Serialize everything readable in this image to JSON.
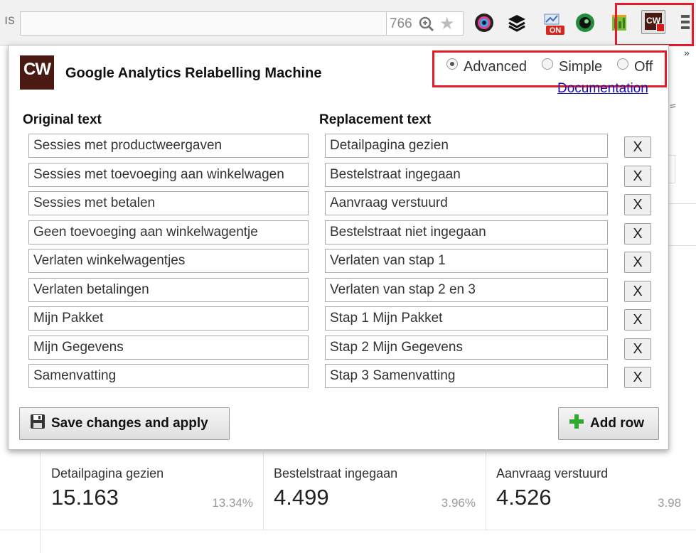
{
  "browser": {
    "address_left_fragment": "ıs",
    "address_right_fragment": "766",
    "icons": [
      "zoom-icon",
      "star-icon",
      "color-eye-extension-icon",
      "layers-extension-icon",
      "on-extension-icon",
      "green-camera-extension-icon",
      "green-bars-extension-icon",
      "cw-extension-icon",
      "chrome-menu-icon",
      "chevron-overflow-icon"
    ],
    "cw_label": "CW",
    "overflow_chevron": "»"
  },
  "popup": {
    "logo_text": "CW",
    "title": "Google Analytics Relabelling Machine",
    "modes": [
      {
        "label": "Advanced",
        "checked": true
      },
      {
        "label": "Simple",
        "checked": false
      },
      {
        "label": "Off",
        "checked": false
      }
    ],
    "documentation_link": "Documentation",
    "original_header": "Original text",
    "replacement_header": "Replacement text",
    "rows": [
      {
        "original": "Sessies met productweergaven",
        "replacement": "Detailpagina gezien",
        "delete": "X"
      },
      {
        "original": "Sessies met toevoeging aan winkelwagen",
        "replacement": "Bestelstraat ingegaan",
        "delete": "X"
      },
      {
        "original": "Sessies met betalen",
        "replacement": "Aanvraag verstuurd",
        "delete": "X"
      },
      {
        "original": "Geen toevoeging aan winkelwagentje",
        "replacement": "Bestelstraat niet ingegaan",
        "delete": "X"
      },
      {
        "original": "Verlaten winkelwagentjes",
        "replacement": "Verlaten van stap 1",
        "delete": "X"
      },
      {
        "original": "Verlaten betalingen",
        "replacement": "Verlaten van stap 2 en 3",
        "delete": "X"
      },
      {
        "original": "Mijn Pakket",
        "replacement": "Stap 1 Mijn Pakket",
        "delete": "X"
      },
      {
        "original": "Mijn Gegevens",
        "replacement": "Stap 2 Mijn Gegevens",
        "delete": "X"
      },
      {
        "original": "Samenvatting",
        "replacement": "Stap 3 Samenvatting",
        "delete": "X"
      }
    ],
    "save_button": "Save changes and apply",
    "add_button": "Add row"
  },
  "metrics": [
    {
      "label": "Detailpagina gezien",
      "value": "15.163",
      "percent": "13.34%"
    },
    {
      "label": "Bestelstraat ingegaan",
      "value": "4.499",
      "percent": "3.96%"
    },
    {
      "label": "Aanvraag verstuurd",
      "value": "4.526",
      "percent": "3.98"
    }
  ],
  "colors": {
    "highlight": "#e21c2a",
    "logo_bg": "#4a1a12",
    "link": "#1a0dab",
    "add_icon": "#2faa2f"
  }
}
